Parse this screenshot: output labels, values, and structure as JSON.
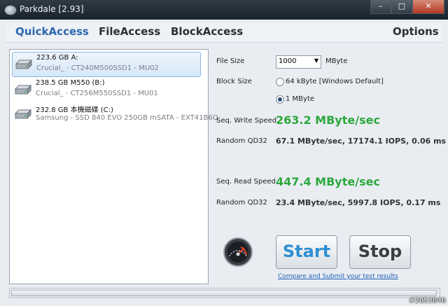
{
  "window": {
    "title": "Parkdale [2.93]"
  },
  "caption": {
    "min": "–",
    "max": "□",
    "close": "✕"
  },
  "menu": {
    "quick": "QuickAccess",
    "file": "FileAccess",
    "block": "BlockAccess",
    "options": "Options"
  },
  "drives": [
    {
      "line1": "223.6 GB  A:",
      "line2": "Crucial_ - CT240M500SSD1 - MU02"
    },
    {
      "line1": "238.5 GB  M550 (B:)",
      "line2": "Crucial_ - CT256M550SSD1 - MU01"
    },
    {
      "line1": "232.8 GB  本機磁碟 (C:)",
      "line2": "Samsung - SSD 840 EVO 250GB mSATA - EXT41B6Q"
    }
  ],
  "settings": {
    "file_size_label": "File Size",
    "file_size_value": "1000",
    "file_size_unit": "MByte",
    "block_size_label": "Block Size",
    "block_opt1": "64 kByte [Windows Default]",
    "block_opt2": "1 MByte"
  },
  "results": {
    "seq_write_label": "Seq. Write Speed",
    "seq_write_value": "263.2 MByte/sec",
    "rand_write_label": "Random QD32",
    "rand_write_value": "67.1 MByte/sec, 17174.1 IOPS, 0.06 ms",
    "seq_read_label": "Seq. Read Speed",
    "seq_read_value": "447.4 MByte/sec",
    "rand_read_label": "Random QD32",
    "rand_read_value": "23.4 MByte/sec, 5997.8 IOPS, 0.17 ms"
  },
  "actions": {
    "start": "Start",
    "stop": "Stop",
    "submit_link": "Compare and Submit your test results"
  },
  "watermark": "#2653846",
  "colors": {
    "accent_green": "#2ca83c",
    "start_blue": "#2e8fd2",
    "menu_active": "#2a68b0"
  }
}
